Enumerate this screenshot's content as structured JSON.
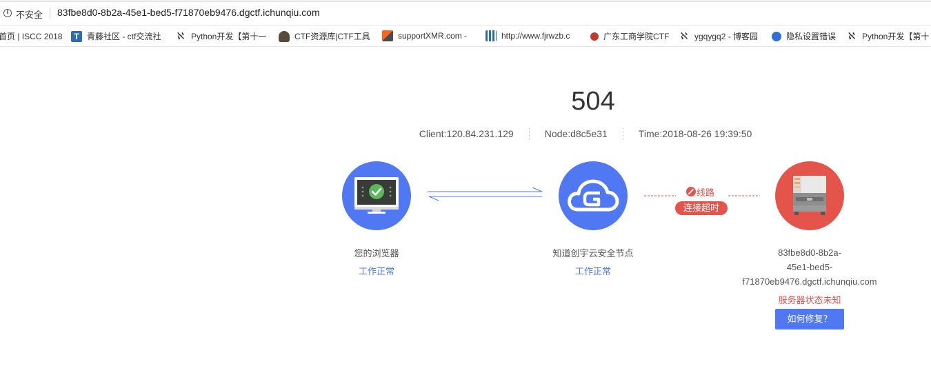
{
  "browser": {
    "security_label": "不安全",
    "url": "83fbe8d0-8b2a-45e1-bed5-f71870eb9476.dgctf.ichunqiu.com"
  },
  "bookmarks": [
    {
      "label": "首页 | ISCC 2018",
      "icon": "none"
    },
    {
      "label": "青藤社区 - ctf交流社",
      "icon": "T-logo-icon"
    },
    {
      "label": "Python开发【第十一",
      "icon": "wave-logo-icon"
    },
    {
      "label": "CTF资源库|CTF工具",
      "icon": "spy-icon"
    },
    {
      "label": "supportXMR.com -",
      "icon": "xmr-icon"
    },
    {
      "label": "http://www.fjrwzb.c",
      "icon": "grid-icon"
    },
    {
      "label": "广东工商学院CTF",
      "icon": "red-dot-icon"
    },
    {
      "label": "ygqygq2 - 博客园",
      "icon": "wave-logo-icon"
    },
    {
      "label": "隐私设置错误",
      "icon": "baidu-paw-icon"
    },
    {
      "label": "Python开发【第十",
      "icon": "wave-logo-icon"
    }
  ],
  "error": {
    "code": "504",
    "client": "Client:120.84.231.129",
    "node": "Node:d8c5e31",
    "time": "Time:2018-08-26 19:39:50"
  },
  "nodes": {
    "browser": {
      "label": "您的浏览器",
      "status": "工作正常"
    },
    "cloud": {
      "label": "知道创宇云安全节点",
      "status": "工作正常"
    },
    "server": {
      "host_line1": "83fbe8d0-8b2a-",
      "host_line2": "45e1-bed5-",
      "host_line3": "f71870eb9476.dgctf.ichunqiu.com",
      "status": "服务器状态未知",
      "fix_button": "如何修复？"
    }
  },
  "link": {
    "route_label": "线路",
    "timeout_label": "连接超时"
  },
  "colors": {
    "accent_blue": "#4f78f2",
    "error_red": "#e5544a",
    "ok_green": "#5cb85c"
  }
}
